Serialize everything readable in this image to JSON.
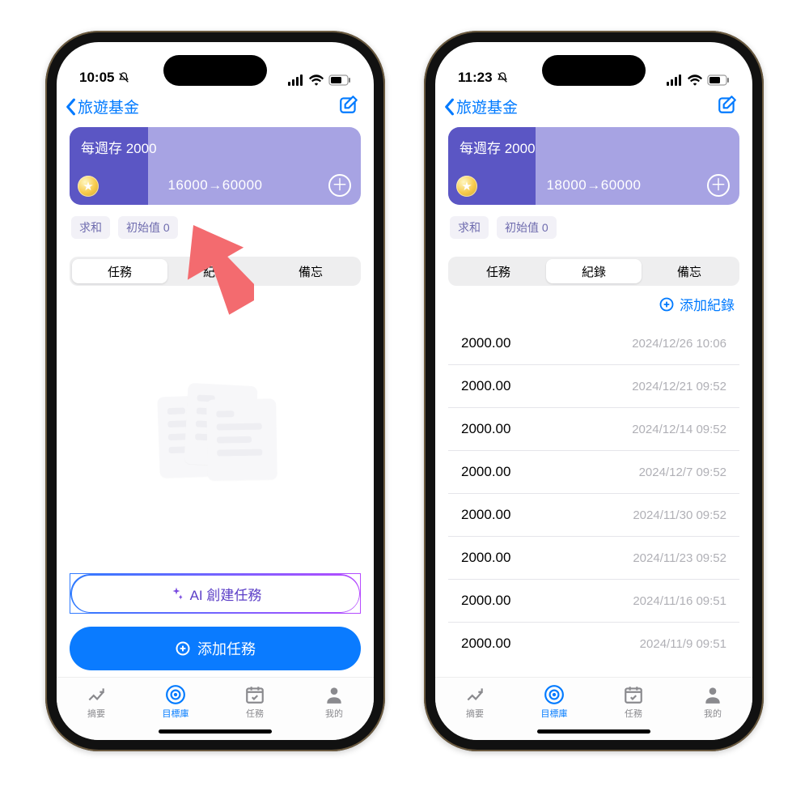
{
  "phones": {
    "left": {
      "status": {
        "time": "10:05"
      },
      "nav": {
        "back": "旅遊基金"
      },
      "card": {
        "title": "每週存 2000",
        "progress_label": "16000→60000",
        "fill_percent": 27
      },
      "chips": {
        "mode": "求和",
        "initial": "初始值 0"
      },
      "seg": {
        "tasks": "任務",
        "records": "紀錄",
        "notes": "備忘",
        "active_index": 0
      },
      "ai_btn": "AI 創建任務",
      "add_btn": "添加任務"
    },
    "right": {
      "status": {
        "time": "11:23"
      },
      "nav": {
        "back": "旅遊基金"
      },
      "card": {
        "title": "每週存 2000",
        "progress_label": "18000→60000",
        "fill_percent": 30
      },
      "chips": {
        "mode": "求和",
        "initial": "初始值 0"
      },
      "seg": {
        "tasks": "任務",
        "records": "紀錄",
        "notes": "備忘",
        "active_index": 1
      },
      "add_record": "添加紀錄",
      "records": [
        {
          "amount": "2000.00",
          "ts": "2024/12/26 10:06"
        },
        {
          "amount": "2000.00",
          "ts": "2024/12/21 09:52"
        },
        {
          "amount": "2000.00",
          "ts": "2024/12/14 09:52"
        },
        {
          "amount": "2000.00",
          "ts": "2024/12/7 09:52"
        },
        {
          "amount": "2000.00",
          "ts": "2024/11/30 09:52"
        },
        {
          "amount": "2000.00",
          "ts": "2024/11/23 09:52"
        },
        {
          "amount": "2000.00",
          "ts": "2024/11/16 09:51"
        },
        {
          "amount": "2000.00",
          "ts": "2024/11/9 09:51"
        }
      ]
    }
  },
  "tabbar": {
    "summary": "摘要",
    "goals": "目標庫",
    "tasks": "任務",
    "mine": "我的",
    "active": "goals"
  }
}
